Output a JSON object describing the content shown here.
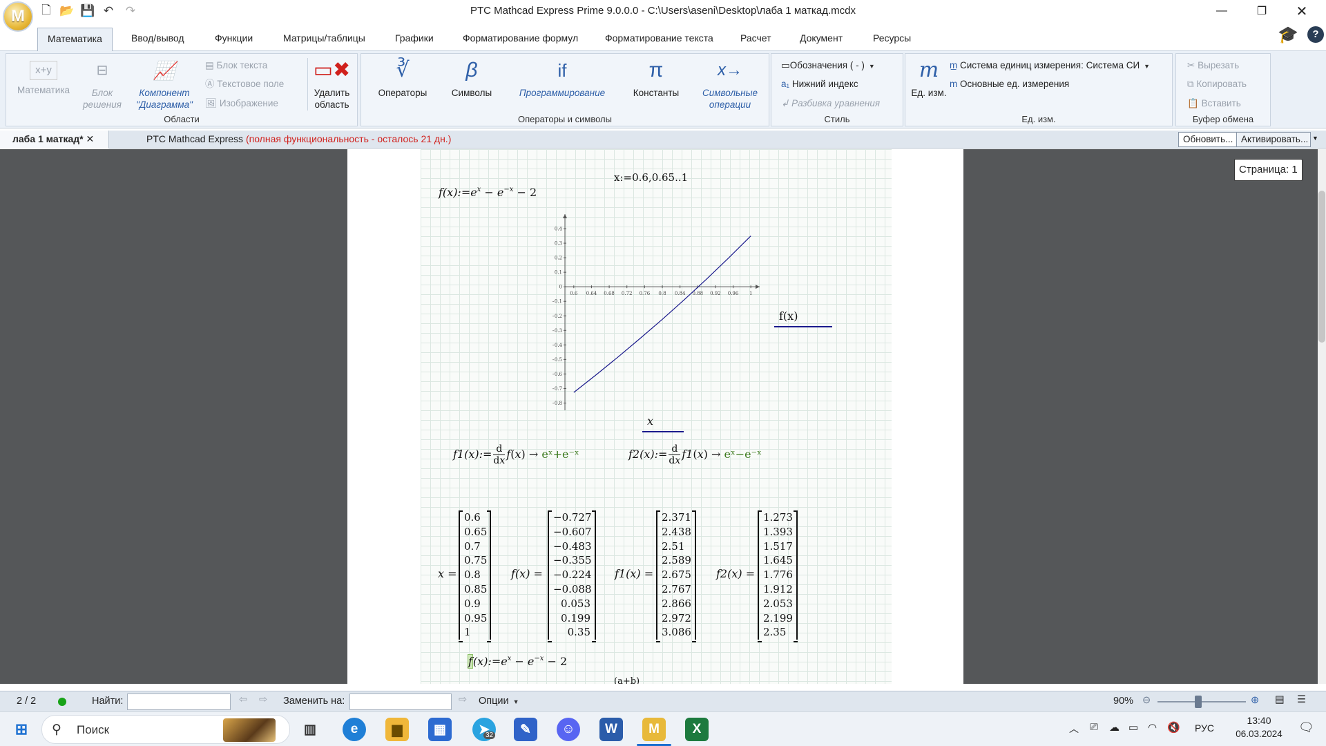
{
  "window": {
    "title": "PTC Mathcad Express Prime 9.0.0.0 - C:\\Users\\aseni\\Desktop\\лаба 1 маткад.mcdx",
    "app_letter": "M"
  },
  "ribbon_tabs": [
    "Математика",
    "Ввод/вывод",
    "Функции",
    "Матрицы/таблицы",
    "Графики",
    "Форматирование формул",
    "Форматирование текста",
    "Расчет",
    "Документ",
    "Ресурсы"
  ],
  "ribbon": {
    "regions": {
      "math": "Математика",
      "solve_block": "Блок решения",
      "chart_component": "Компонент \"Диаграмма\"",
      "text_block": "Блок текста",
      "text_box": "Текстовое поле",
      "image": "Изображение",
      "delete_region": "Удалить область",
      "label": "Области"
    },
    "operators": {
      "operators": "Операторы",
      "symbols": "Символы",
      "programming": "Программирование",
      "constants": "Константы",
      "symbolic": "Символьные операции",
      "label": "Операторы и символы"
    },
    "style": {
      "labels": "Обозначения",
      "labels_value": "( - )",
      "subscript": "Нижний индекс",
      "break_eq": "Разбивка уравнения",
      "label": "Стиль"
    },
    "units": {
      "units_btn": "Ед. изм.",
      "system": "Система единиц измерения:",
      "system_value": "Система СИ",
      "base": "Основные ед. измерения",
      "label": "Ед. изм."
    },
    "clipboard": {
      "cut": "Вырезать",
      "copy": "Копировать",
      "paste": "Вставить",
      "label": "Буфер обмена"
    }
  },
  "doc_tab": "лаба 1 маткад*",
  "message": {
    "product": "PTC Mathcad Express",
    "warning": "(полная функциональность - осталось 21 дн.)",
    "update": "Обновить...",
    "activate": "Активировать..."
  },
  "page_badge": "Страница: 1",
  "worksheet": {
    "range_def": "x:=0.6,0.65..1",
    "f_def_lhs": "f(x):=",
    "f1_def_lhs": "f1(x):=",
    "f2_def_lhs": "f2(x):=",
    "f1_result": "eˣ+e⁻ˣ",
    "f2_result": "eˣ−e⁻ˣ",
    "legend_label": "f(x)",
    "x_axis_label": "x",
    "bottom_partial": "(a+b)"
  },
  "matrices": {
    "x": [
      "0.6",
      "0.65",
      "0.7",
      "0.75",
      "0.8",
      "0.85",
      "0.9",
      "0.95",
      "1"
    ],
    "f": [
      "−0.727",
      "−0.607",
      "−0.483",
      "−0.355",
      "−0.224",
      "−0.088",
      "0.053",
      "0.199",
      "0.35"
    ],
    "f1": [
      "2.371",
      "2.438",
      "2.51",
      "2.589",
      "2.675",
      "2.767",
      "2.866",
      "2.972",
      "3.086"
    ],
    "f2": [
      "1.273",
      "1.393",
      "1.517",
      "1.645",
      "1.776",
      "1.912",
      "2.053",
      "2.199",
      "2.35"
    ],
    "labels": {
      "x": "x =",
      "f": "f(x) =",
      "f1": "f1(x) =",
      "f2": "f2(x) ="
    }
  },
  "chart_data": {
    "type": "line",
    "x": [
      0.6,
      0.65,
      0.7,
      0.75,
      0.8,
      0.85,
      0.9,
      0.95,
      1.0
    ],
    "series": [
      {
        "name": "f(x)",
        "values": [
          -0.727,
          -0.607,
          -0.483,
          -0.355,
          -0.224,
          -0.088,
          0.053,
          0.199,
          0.35
        ],
        "color": "#1a1a8c"
      }
    ],
    "xticks": [
      "0.6",
      "0.64",
      "0.68",
      "0.72",
      "0.76",
      "0.8",
      "0.84",
      "0.88",
      "0.92",
      "0.96",
      "1"
    ],
    "yticks": [
      "0.4",
      "0.3",
      "0.2",
      "0.1",
      "0",
      "−0.1",
      "−0.2",
      "−0.3",
      "−0.4",
      "−0.5",
      "−0.6",
      "−0.7",
      "−0.8"
    ],
    "xlabel": "x",
    "ylabel": "f(x)",
    "xlim": [
      0.58,
      1.02
    ],
    "ylim": [
      -0.85,
      0.5
    ]
  },
  "status": {
    "page_count": "2 / 2",
    "find_label": "Найти:",
    "replace_label": "Заменить на:",
    "options": "Опции",
    "zoom": "90%"
  },
  "taskbar": {
    "search": "Поиск",
    "lang": "РУС",
    "time": "13:40",
    "date": "06.03.2024",
    "telegram_badge": "32"
  },
  "colors": {
    "accent": "#2e5fa8",
    "warning": "#d0201c",
    "plot_line": "#1a1a8c",
    "expr_green": "#3c7a1e"
  }
}
